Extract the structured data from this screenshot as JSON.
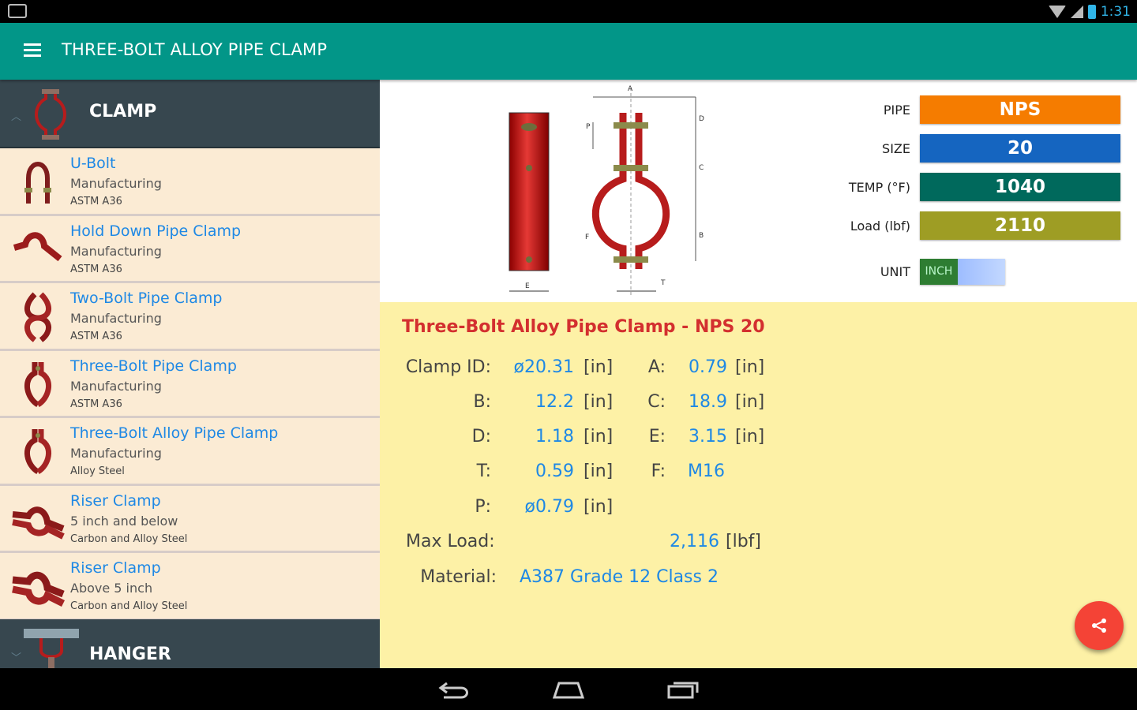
{
  "status_bar": {
    "time": "1:31"
  },
  "toolbar": {
    "title": "THREE-BOLT ALLOY PIPE CLAMP"
  },
  "sidebar": {
    "group": "CLAMP",
    "items": [
      {
        "title": "U-Bolt",
        "line1": "Manufacturing",
        "line2": "ASTM A36"
      },
      {
        "title": "Hold Down Pipe Clamp",
        "line1": "Manufacturing",
        "line2": "ASTM A36"
      },
      {
        "title": "Two-Bolt Pipe Clamp",
        "line1": "Manufacturing",
        "line2": "ASTM A36"
      },
      {
        "title": "Three-Bolt Pipe Clamp",
        "line1": "Manufacturing",
        "line2": "ASTM A36"
      },
      {
        "title": "Three-Bolt Alloy Pipe Clamp",
        "line1": "Manufacturing",
        "line2": "Alloy Steel"
      },
      {
        "title": "Riser Clamp",
        "line1": "5 inch and below",
        "line2": "Carbon and Alloy Steel"
      },
      {
        "title": "Riser Clamp",
        "line1": "Above 5 inch",
        "line2": "Carbon and Alloy Steel"
      }
    ],
    "next_group": "HANGER"
  },
  "drawing_labels": {
    "A": "A",
    "B": "B",
    "C": "C",
    "D": "D",
    "E": "E",
    "F": "F",
    "P": "P",
    "T": "T"
  },
  "params": {
    "pipe": {
      "label": "PIPE",
      "value": "NPS",
      "color": "#f57c00"
    },
    "size": {
      "label": "SIZE",
      "value": "20",
      "color": "#1565c0"
    },
    "temp": {
      "label": "TEMP (°F)",
      "value": "1040",
      "color": "#00695c"
    },
    "load": {
      "label": "Load (lbf)",
      "value": "2110",
      "color": "#9e9d24"
    },
    "unit": {
      "label": "UNIT",
      "value": "INCH"
    }
  },
  "results": {
    "title": "Three-Bolt Alloy Pipe Clamp - NPS 20",
    "clamp_id": {
      "label": "Clamp ID:",
      "value": "ø20.31",
      "unit": "[in]"
    },
    "a": {
      "label": "A:",
      "value": "0.79",
      "unit": "[in]"
    },
    "b": {
      "label": "B:",
      "value": "12.2",
      "unit": "[in]"
    },
    "c": {
      "label": "C:",
      "value": "18.9",
      "unit": "[in]"
    },
    "d": {
      "label": "D:",
      "value": "1.18",
      "unit": "[in]"
    },
    "e": {
      "label": "E:",
      "value": "3.15",
      "unit": "[in]"
    },
    "t": {
      "label": "T:",
      "value": "0.59",
      "unit": "[in]"
    },
    "f": {
      "label": "F:",
      "value": "M16"
    },
    "p": {
      "label": "P:",
      "value": "ø0.79",
      "unit": "[in]"
    },
    "max_load": {
      "label": "Max Load:",
      "value": "2,116",
      "unit": "[lbf]"
    },
    "material": {
      "label": "Material:",
      "value": "A387 Grade 12 Class 2"
    }
  },
  "icons": {
    "menu": "menu-icon",
    "fab": "share-icon",
    "back": "back-icon",
    "home": "home-icon",
    "recents": "recents-icon"
  }
}
